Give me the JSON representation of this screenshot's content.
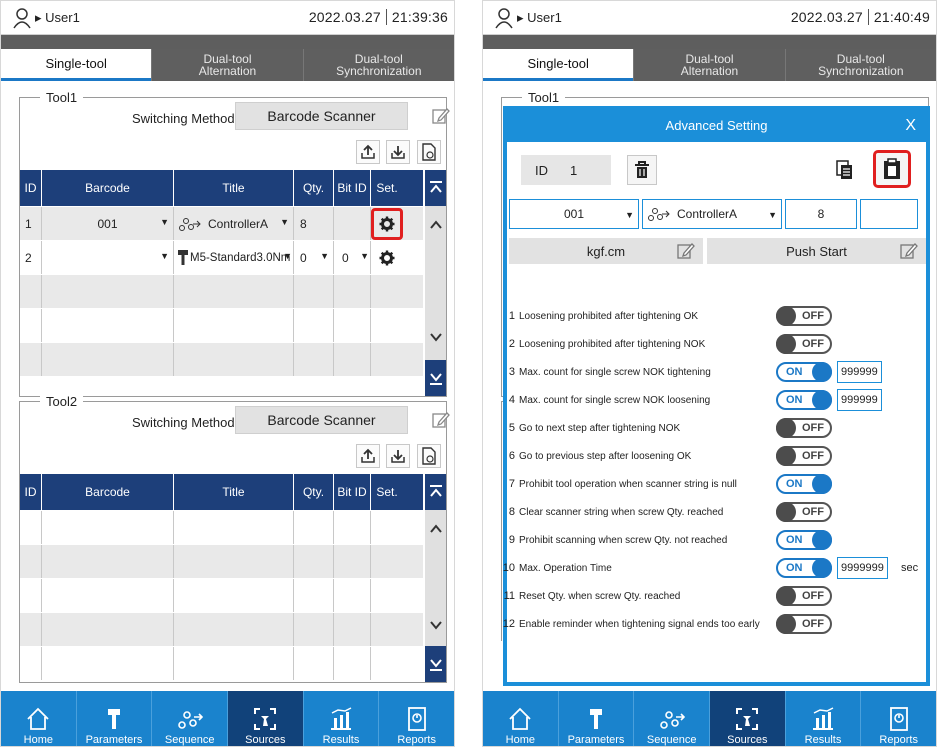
{
  "left": {
    "user": "User1",
    "date": "2022.03.27",
    "time": "21:39:36",
    "tabs": [
      {
        "line1": "Single-tool",
        "line2": ""
      },
      {
        "line1": "Dual-tool",
        "line2": "Alternation"
      },
      {
        "line1": "Dual-tool",
        "line2": "Synchronization"
      }
    ],
    "tool1": {
      "title": "Tool1",
      "switch_label": "Switching Method",
      "switch_value": "Barcode Scanner",
      "columns": [
        "ID",
        "Barcode",
        "Title",
        "Qty.",
        "Bit ID",
        "Set."
      ],
      "rows": [
        {
          "id": "1",
          "barcode": "001",
          "title": "ControllerA",
          "qty": "8",
          "bit": ""
        },
        {
          "id": "2",
          "barcode": "",
          "title": "M5-Standard3.0Nm",
          "qty": "0",
          "bit": "0"
        }
      ]
    },
    "tool2": {
      "title": "Tool2",
      "switch_label": "Switching Method",
      "switch_value": "Barcode Scanner",
      "columns": [
        "ID",
        "Barcode",
        "Title",
        "Qty.",
        "Bit ID",
        "Set."
      ]
    }
  },
  "right": {
    "user": "User1",
    "date": "2022.03.27",
    "time": "21:40:49",
    "tool1_title": "Tool1"
  },
  "nav": [
    "Home",
    "Parameters",
    "Sequence",
    "Sources",
    "Results",
    "Reports"
  ],
  "modal": {
    "title": "Advanced Setting",
    "close": "X",
    "id_label": "ID",
    "id_value": "1",
    "barcode": "001",
    "controller": "ControllerA",
    "qty": "8",
    "unit": "kgf.cm",
    "start": "Push Start",
    "on_text": "ON",
    "off_text": "OFF",
    "options": [
      {
        "n": "1",
        "label": "Loosening prohibited after tightening OK",
        "state": "off",
        "value": "",
        "unit": ""
      },
      {
        "n": "2",
        "label": "Loosening prohibited after tightening NOK",
        "state": "off",
        "value": "",
        "unit": ""
      },
      {
        "n": "3",
        "label": "Max. count for single screw NOK tightening",
        "state": "on",
        "value": "999999",
        "unit": ""
      },
      {
        "n": "4",
        "label": "Max. count for single screw NOK loosening",
        "state": "on",
        "value": "999999",
        "unit": ""
      },
      {
        "n": "5",
        "label": "Go to next step after tightening NOK",
        "state": "off",
        "value": "",
        "unit": ""
      },
      {
        "n": "6",
        "label": "Go to previous step after loosening OK",
        "state": "off",
        "value": "",
        "unit": ""
      },
      {
        "n": "7",
        "label": "Prohibit tool operation when scanner string is null",
        "state": "on",
        "value": "",
        "unit": ""
      },
      {
        "n": "8",
        "label": "Clear scanner string when screw Qty. reached",
        "state": "off",
        "value": "",
        "unit": ""
      },
      {
        "n": "9",
        "label": "Prohibit scanning when screw Qty. not reached",
        "state": "on",
        "value": "",
        "unit": ""
      },
      {
        "n": "10",
        "label": "Max. Operation Time",
        "state": "on",
        "value": "9999999",
        "unit": "sec"
      },
      {
        "n": "11",
        "label": "Reset Qty. when screw Qty. reached",
        "state": "off",
        "value": "",
        "unit": ""
      },
      {
        "n": "12",
        "label": "Enable reminder when tightening signal ends too early",
        "state": "off",
        "value": "",
        "unit": ""
      }
    ]
  },
  "colors": {
    "accent": "#1b8fd9",
    "header": "#1d3f7a",
    "highlight": "#e01f1f",
    "nav": "#1a83cd"
  }
}
